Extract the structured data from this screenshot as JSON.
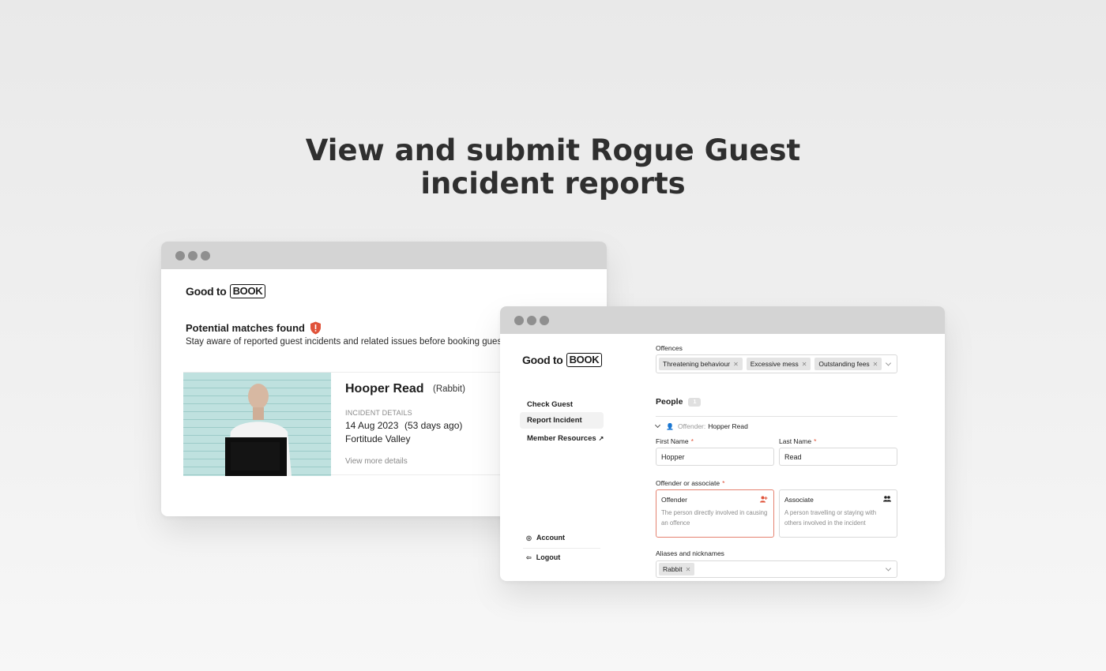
{
  "hero": {
    "line1": "View and submit Rogue Guest",
    "line2": "incident reports"
  },
  "colors": {
    "accent_red": "#e0533a",
    "titlebar": "#d4d4d4",
    "text": "#1d1d1d"
  },
  "brand": {
    "part1": "Good to",
    "part2": "BOOK"
  },
  "matches": {
    "heading": "Potential matches found",
    "subtitle": "Stay aware of reported guest incidents and related issues before booking guests",
    "card": {
      "name": "Hooper Read",
      "nickname": "(Rabbit)",
      "details_label": "INCIDENT DETAILS",
      "date": "14 Aug 2023",
      "ago": "(53 days ago)",
      "location": "Fortitude Valley",
      "link": "View more details"
    }
  },
  "sidebar": {
    "items": [
      {
        "label": "Check Guest"
      },
      {
        "label": "Report Incident",
        "active": true
      },
      {
        "label": "Member Resources",
        "icon": "external-link-icon"
      }
    ],
    "footer": [
      {
        "label": "Account",
        "icon": "account-icon"
      },
      {
        "label": "Logout",
        "icon": "logout-icon"
      }
    ]
  },
  "form": {
    "offences_label": "Offences",
    "offences": [
      "Threatening behaviour",
      "Excessive mess",
      "Outstanding fees"
    ],
    "people_title": "People",
    "people_count": "1",
    "offender_prefix": "Offender:",
    "offender_name": "Hopper Read",
    "first_name_label": "First Name",
    "first_name_value": "Hopper",
    "last_name_label": "Last Name",
    "last_name_value": "Read",
    "role_label": "Offender or associate",
    "roles": [
      {
        "title": "Offender",
        "desc": "The person directly involved in causing an offence",
        "selected": true
      },
      {
        "title": "Associate",
        "desc": "A person travelling or staying with others involved in the incident",
        "selected": false
      }
    ],
    "aliases_label": "Aliases and nicknames",
    "aliases": [
      "Rabbit"
    ]
  }
}
